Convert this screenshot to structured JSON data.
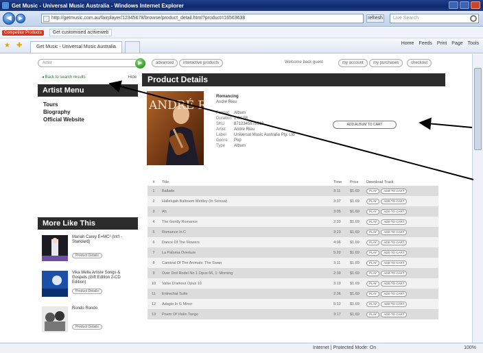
{
  "window": {
    "title": "Get Music - Universal Music Australia - Windows Internet Explorer",
    "url": "http://getmusic.com.au/fairplayer/12345678/browse/product_detail.html?product=16563638",
    "refresh_label": "refresh",
    "search_placeholder": "Live Search"
  },
  "links_bar": {
    "badge": "Competitor Products",
    "item": "Get customised activeweb"
  },
  "tabs": {
    "active": "Get Music - Universal Music Australia",
    "commands": [
      "Home",
      "Feeds",
      "Print",
      "Page",
      "Tools"
    ]
  },
  "site_strip": {
    "search_placeholder": "Artist",
    "go": "▶",
    "pills": [
      "advanced",
      "interactive products"
    ],
    "label": "Welcome back guest",
    "right_pills": [
      "my account",
      "my purchases",
      "checkout"
    ]
  },
  "left": {
    "back_link": "◂ Back to search results",
    "back_close": "Hide",
    "menu_title": "Artist Menu",
    "menu_items": [
      "Tours",
      "Biography",
      "Official Website"
    ],
    "more_title": "More Like This",
    "more_items": [
      {
        "name": "Mariah Carey E=MC² (Int'l - Standard)",
        "btn": "Product Details"
      },
      {
        "name": "Vika Mella Artiste Songs & Gospels (Gift Edition 2-CD Edition)",
        "btn": "Product Details"
      },
      {
        "name": "Rondo Rondo",
        "btn": "Product Details"
      }
    ]
  },
  "product": {
    "heading": "Product Details",
    "cover_text": "ANDRÉ RIEU",
    "album_title": "Romancing",
    "album_artist": "Andre Rieu",
    "detail_rows": [
      {
        "k": "Format",
        "v": "Album"
      },
      {
        "k": "Duration",
        "v": "1:04:58"
      },
      {
        "k": "SKU",
        "v": "8712345678913"
      },
      {
        "k": "Artist",
        "v": "Andre Rieu"
      },
      {
        "k": "Label",
        "v": "Universal Music Australia Pty. Ltd"
      },
      {
        "k": "Genre",
        "v": "Pop"
      },
      {
        "k": "Type",
        "v": "Album"
      }
    ],
    "add_button": "ADD ALBUM TO CART",
    "track_headers": [
      "#",
      "Title",
      "Time",
      "Price",
      "Download Track"
    ],
    "track_btn_a": "PLAY",
    "track_btn_b": "ADD TO CART",
    "tracks": [
      {
        "n": "1",
        "title": "Ballade",
        "time": "3:11",
        "price": "$1.69"
      },
      {
        "n": "2",
        "title": "Hallelujah Ballroom Medley (In Sorrow)",
        "time": "3:37",
        "price": "$1.69"
      },
      {
        "n": "3",
        "title": "Ah",
        "time": "3:05",
        "price": "$1.69"
      },
      {
        "n": "4",
        "title": "The Gently Romance",
        "time": "2:33",
        "price": "$1.69"
      },
      {
        "n": "5",
        "title": "Romance In C",
        "time": "3:23",
        "price": "$1.69"
      },
      {
        "n": "6",
        "title": "Dance Of The Flowers",
        "time": "4:06",
        "price": "$1.69"
      },
      {
        "n": "7",
        "title": "La Paloma Overture",
        "time": "5:20",
        "price": "$1.69"
      },
      {
        "n": "8",
        "title": "Carnival Of The Animals: The Swan",
        "time": "3:11",
        "price": "$1.69"
      },
      {
        "n": "9",
        "title": "Over Doil Rodel No 1 Opus 66, 1: Morning",
        "time": "2:39",
        "price": "$1.69"
      },
      {
        "n": "10",
        "title": "Valse D'amour Opus 10",
        "time": "3:19",
        "price": "$1.69"
      },
      {
        "n": "11",
        "title": "Entrechat Suite",
        "time": "2:36",
        "price": "$1.69"
      },
      {
        "n": "12",
        "title": "Adagio In G Minor",
        "time": "5:12",
        "price": "$1.69"
      },
      {
        "n": "13",
        "title": "Poem Of Violin Tango",
        "time": "3:17",
        "price": "$1.69"
      }
    ]
  },
  "status": {
    "zone": "Internet | Protected Mode: On",
    "zoom": "100%"
  },
  "colors": {
    "header_dark": "#2c2c2c",
    "ie_frame": "#1f3f8a",
    "row_a": "#dcdcdc",
    "row_b": "#f2f2f2",
    "go_green": "#2e9a24"
  }
}
